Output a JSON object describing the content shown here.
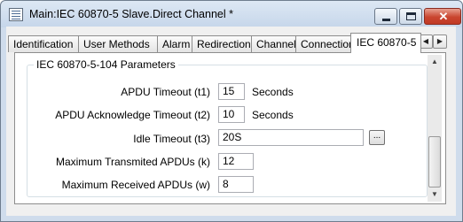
{
  "window": {
    "title": "Main:IEC 60870-5 Slave.Direct Channel *",
    "icon": "properties-window-icon"
  },
  "titlebar_buttons": {
    "minimize_icon": "minimize-icon",
    "maximize_icon": "maximize-icon",
    "close_glyph": "✕"
  },
  "tabs": [
    {
      "label": "Identification"
    },
    {
      "label": "User Methods"
    },
    {
      "label": "Alarm"
    },
    {
      "label": "Redirection"
    },
    {
      "label": "Channel"
    },
    {
      "label": "Connection"
    },
    {
      "label": "IEC 60870-5",
      "active": true
    }
  ],
  "tab_scroll": {
    "left_glyph": "◀",
    "right_glyph": "▶"
  },
  "group": {
    "legend": "IEC 60870-5-104 Parameters",
    "fields": [
      {
        "label": "APDU Timeout (t1)",
        "value": "15",
        "unit": "Seconds"
      },
      {
        "label": "APDU Acknowledge Timeout (t2)",
        "value": "10",
        "unit": "Seconds"
      },
      {
        "label": "Idle Timeout (t3)",
        "value": "20S",
        "browse": "..."
      },
      {
        "label": "Maximum Transmited APDUs (k)",
        "value": "12"
      },
      {
        "label": "Maximum Received APDUs (w)",
        "value": "8"
      }
    ]
  },
  "scrollbar": {
    "up_glyph": "▲",
    "down_glyph": "▼"
  }
}
